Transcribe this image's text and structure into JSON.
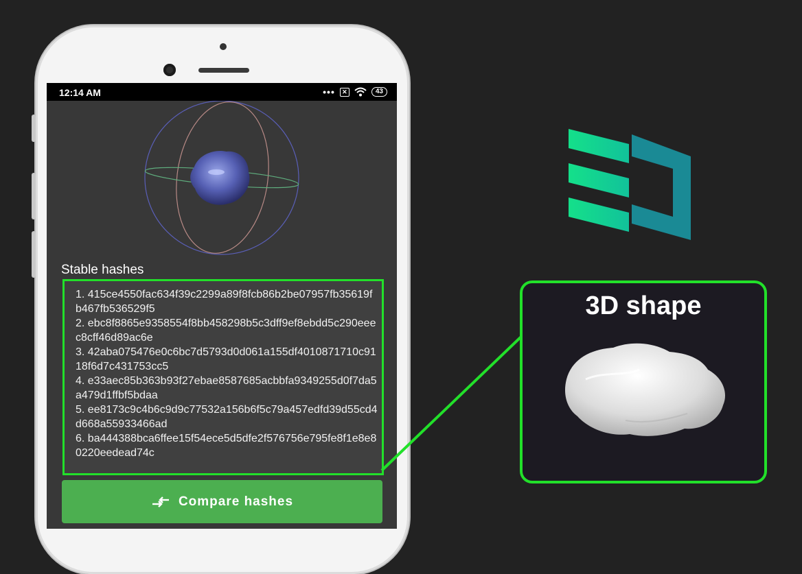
{
  "status_bar": {
    "time": "12:14 AM",
    "dots": "•••",
    "battery": "43"
  },
  "hashes": {
    "title": "Stable hashes",
    "items": [
      "1. 415ce4550fac634f39c2299a89f8fcb86b2be07957fb35619fb467fb536529f5",
      "2. ebc8f8865e9358554f8bb458298b5c3dff9ef8ebdd5c290eeec8cff46d89ac6e",
      "3. 42aba075476e0c6bc7d5793d0d061a155df4010871710c9118f6d7c431753cc5",
      "4. e33aec85b363b93f27ebae8587685acbbfa9349255d0f7da5a479d1ffbf5bdaa",
      "5. ee8173c9c4b6c9d9c77532a156b6f5c79a457edfd39d55cd4d668a55933466ad",
      "6. ba444388bca6ffee15f54ece5d5dfe2f576756e795fe8f1e8e80220eedead74c"
    ]
  },
  "compare_button": {
    "label": "Compare hashes",
    "icon": "compare-arrows-icon"
  },
  "callout": {
    "title": "3D shape"
  },
  "colors": {
    "highlight": "#22e02a",
    "button": "#4caf50",
    "logo_green": "#14e08a",
    "logo_teal": "#1a8a95"
  }
}
